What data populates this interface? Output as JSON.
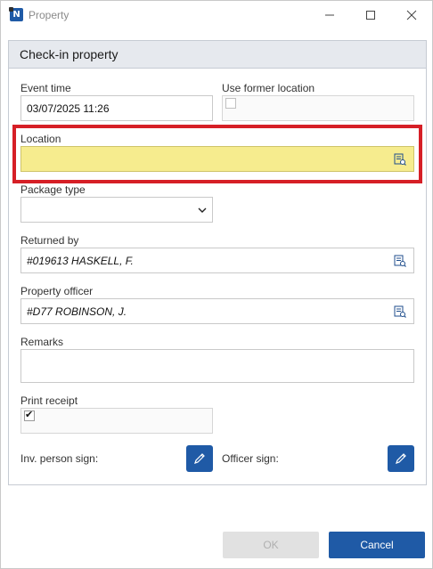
{
  "window": {
    "title": "Property",
    "app_icon_letter": "N",
    "controls": [
      "minimize-icon",
      "maximize-icon",
      "close-icon"
    ]
  },
  "panel": {
    "title": "Check-in property"
  },
  "form": {
    "event_time": {
      "label": "Event time",
      "value": "03/07/2025 11:26"
    },
    "use_former_location": {
      "label": "Use former location",
      "checked": false
    },
    "location": {
      "label": "Location",
      "value": "",
      "highlight_color": "#f6ec8e",
      "outline_color": "#d61f26"
    },
    "package_type": {
      "label": "Package type",
      "value": ""
    },
    "returned_by": {
      "label": "Returned by",
      "value": "#019613 HASKELL, F."
    },
    "property_officer": {
      "label": "Property officer",
      "value": "#D77 ROBINSON, J."
    },
    "remarks": {
      "label": "Remarks",
      "value": ""
    },
    "print_receipt": {
      "label": "Print receipt",
      "checked": true,
      "mark": "✔"
    },
    "inv_person_sign": {
      "label": "Inv. person sign:"
    },
    "officer_sign": {
      "label": "Officer sign:"
    }
  },
  "footer": {
    "ok_label": "OK",
    "cancel_label": "Cancel"
  },
  "colors": {
    "accent": "#1f5aa6",
    "header_bg": "#e6e9ee"
  }
}
